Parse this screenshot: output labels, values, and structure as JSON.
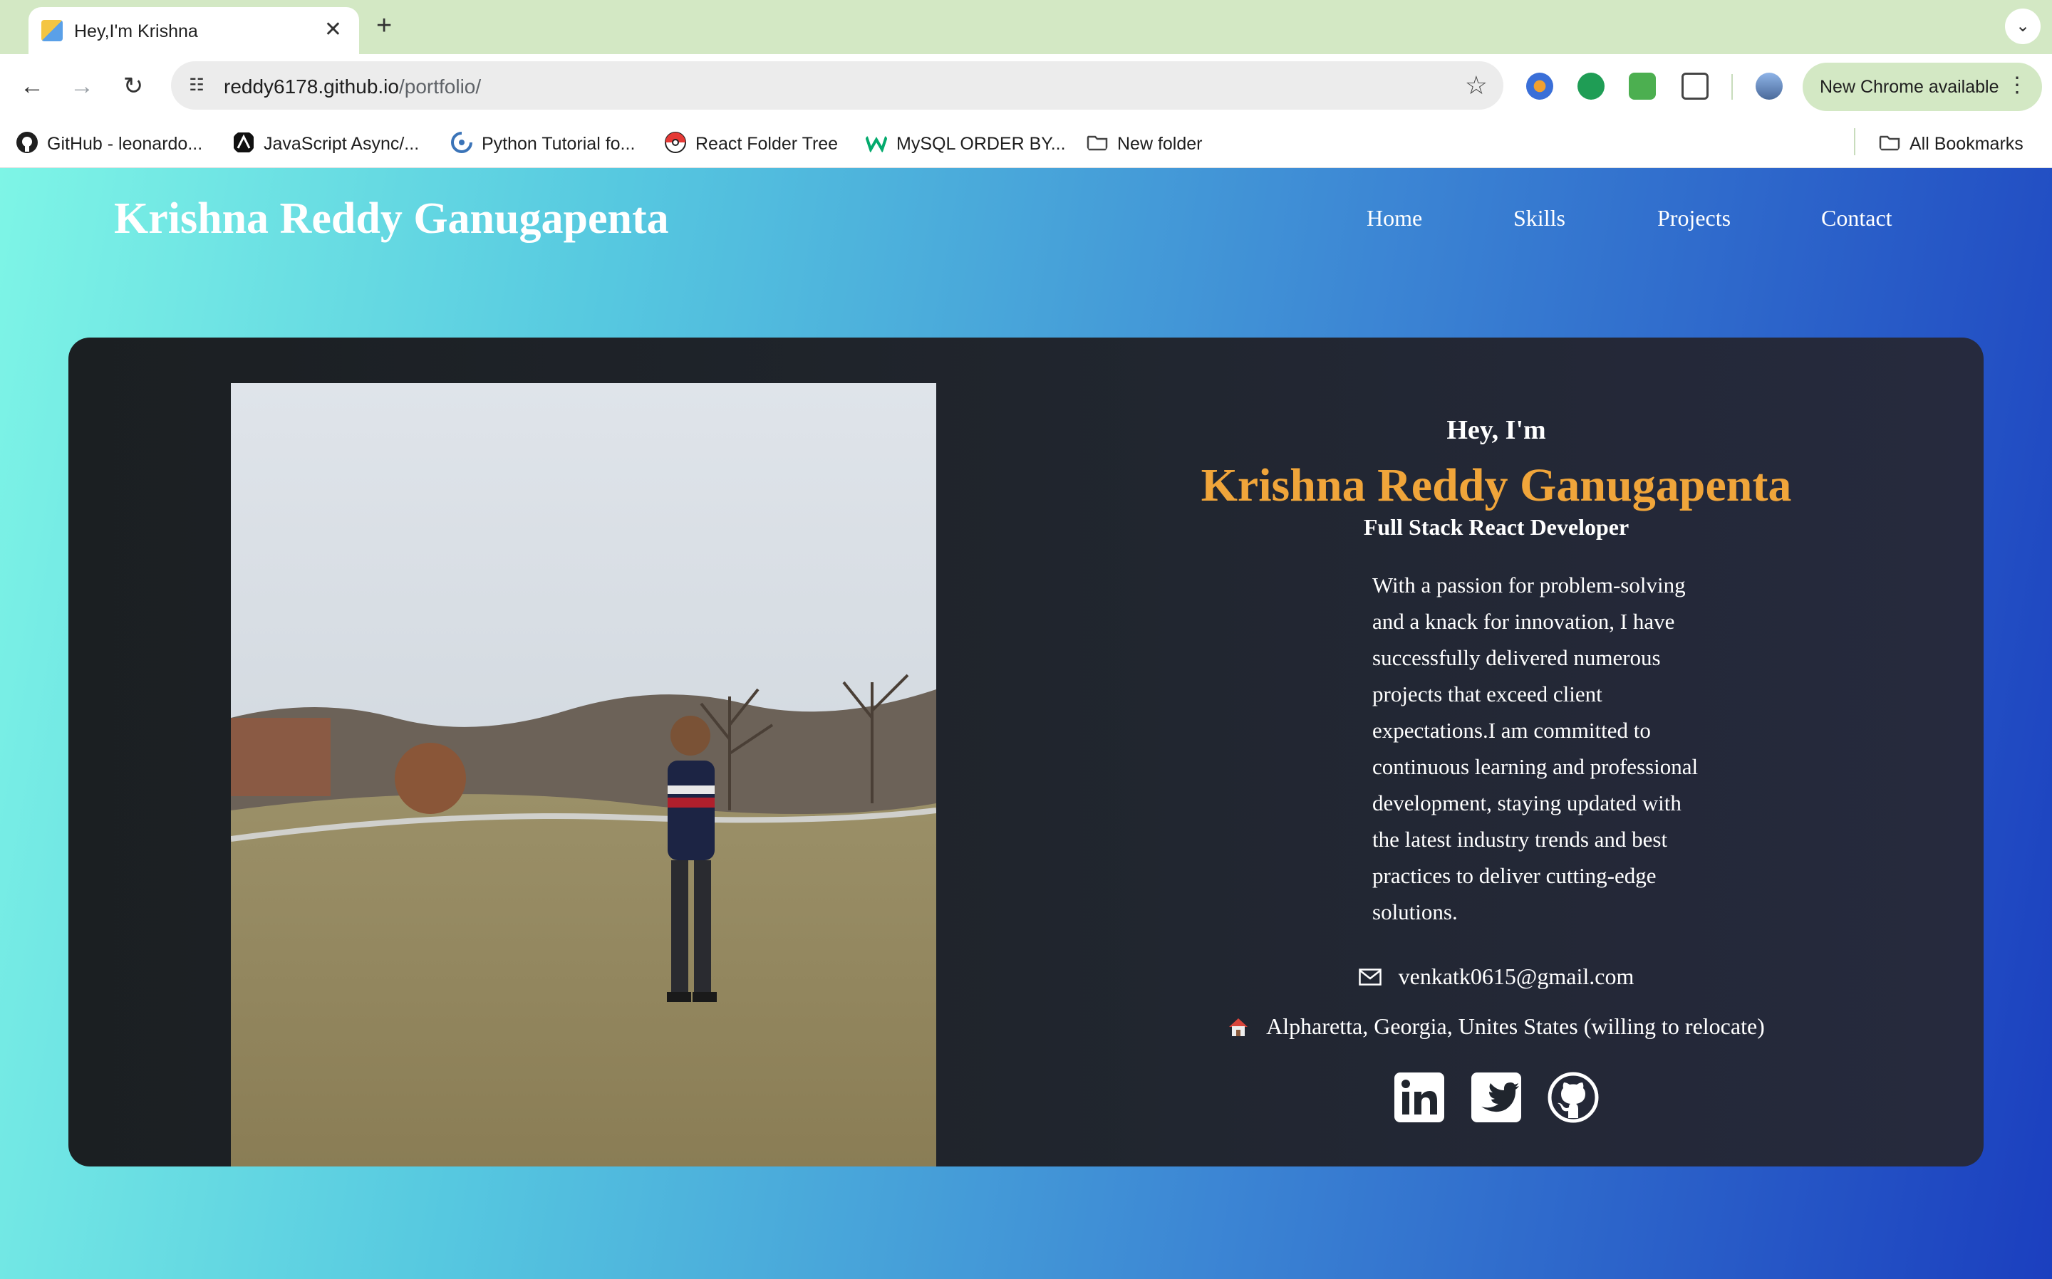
{
  "browser": {
    "tab": {
      "title": "Hey,I'm Krishna",
      "close_glyph": "✕"
    },
    "new_tab_glyph": "+",
    "tab_menu_glyph": "⌄",
    "url": {
      "host": "reddy6178.github.io",
      "path": "/portfolio/"
    },
    "update_label": "New Chrome available",
    "bookmarks": [
      {
        "label": "GitHub - leonardo...",
        "icon": "github-icon"
      },
      {
        "label": "JavaScript Async/...",
        "icon": "javascript-icon"
      },
      {
        "label": "Python Tutorial fo...",
        "icon": "python-icon"
      },
      {
        "label": "React Folder Tree",
        "icon": "pokeball-icon"
      },
      {
        "label": "MySQL ORDER BY...",
        "icon": "w3schools-icon"
      },
      {
        "label": "New folder",
        "icon": "folder-icon"
      }
    ],
    "all_bookmarks": "All Bookmarks"
  },
  "header": {
    "brand": "Krishna Reddy Ganugapenta",
    "nav": [
      "Home",
      "Skills",
      "Projects",
      "Contact"
    ]
  },
  "hero": {
    "greeting": "Hey, I'm",
    "name": "Krishna Reddy Ganugapenta",
    "role": "Full Stack React Developer",
    "bio": "With a passion for problem-solving and a knack for innovation, I have successfully delivered numerous projects that exceed client expectations.I am committed to continuous learning and professional development, staying updated with the latest industry trends and best practices to deliver cutting-edge solutions.",
    "email": "venkatk0615@gmail.com",
    "location": "Alpharetta, Georgia, Unites States (willing to relocate)",
    "socials": [
      "linkedin-icon",
      "twitter-icon",
      "github-icon"
    ]
  },
  "colors": {
    "accent_name": "#f0a53a",
    "card_bg": "#20252d",
    "gradient_start": "#7ef5e6",
    "gradient_end": "#1b3fbf"
  }
}
